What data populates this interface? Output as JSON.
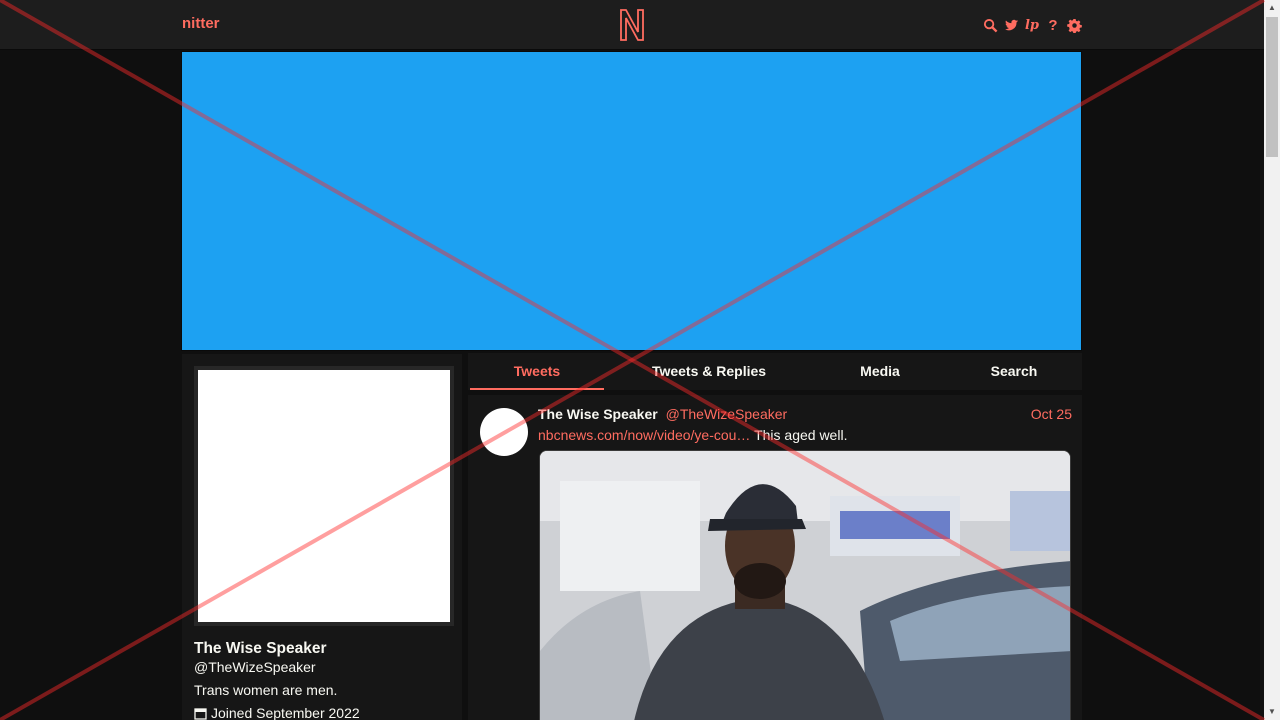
{
  "navbar": {
    "brand": "nitter",
    "logo_letter": "N",
    "icons": [
      "search-icon",
      "twitter-bird-icon",
      "liberapay-icon",
      "help-icon",
      "settings-gear-icon"
    ],
    "help_label": "?",
    "lp_label": "lp"
  },
  "banner": {
    "color": "#1da1f2"
  },
  "profile": {
    "name": "The Wise Speaker",
    "handle": "@TheWizeSpeaker",
    "bio": "Trans women are men.",
    "joined": "Joined September 2022"
  },
  "tabs": [
    {
      "label": "Tweets",
      "active": true
    },
    {
      "label": "Tweets & Replies",
      "active": false
    },
    {
      "label": "Media",
      "active": false
    },
    {
      "label": "Search",
      "active": false
    }
  ],
  "tweet": {
    "author_name": "The Wise Speaker",
    "author_handle": "@TheWizeSpeaker",
    "date": "Oct 25",
    "link_text": "nbcnews.com/now/video/ye-cou…",
    "text": " This aged well."
  },
  "colors": {
    "accent": "#ff6c60",
    "background": "#0f0f0f",
    "panel": "#161616",
    "navbar": "#1d1d1d"
  }
}
